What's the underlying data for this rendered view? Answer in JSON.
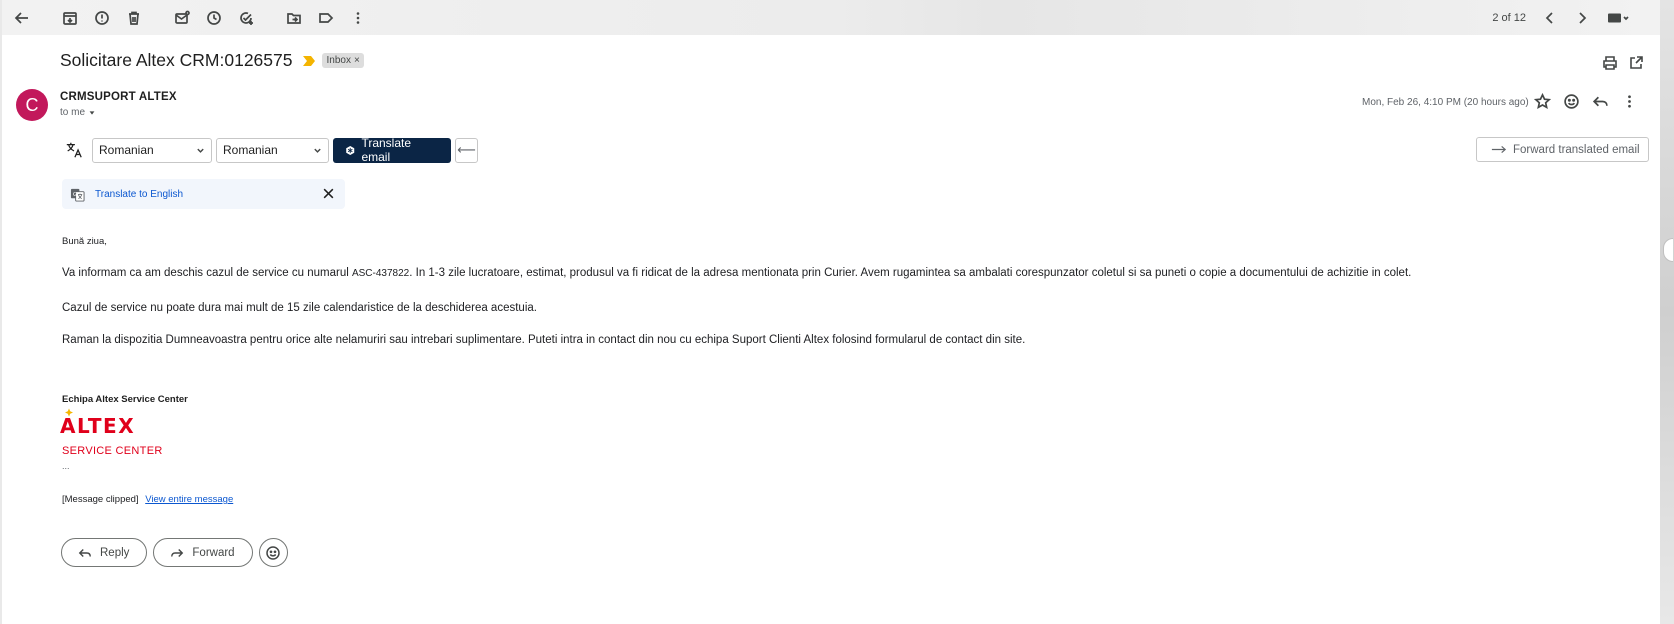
{
  "toolbar": {
    "icons": [
      "back-arrow-icon",
      "archive-icon",
      "report-spam-icon",
      "delete-icon",
      "mark-unread-icon",
      "snooze-icon",
      "add-task-icon",
      "move-to-icon",
      "label-icon",
      "more-vert-icon"
    ],
    "pager": "2 of 12"
  },
  "email": {
    "subject": "Solicitare Altex CRM:0126575",
    "label": "Inbox",
    "label_close": "×",
    "sender_initial": "C",
    "sender": "CRMSUPORT ALTEX",
    "to": "to me",
    "date": "Mon, Feb 26, 4:10 PM (20 hours ago)"
  },
  "translate": {
    "from_lang": "Romanian",
    "to_lang": "Romanian",
    "translate_btn": "Translate email",
    "back_arrow": "⟵",
    "forward_translated": "Forward translated email",
    "translate_to_english": "Translate to English"
  },
  "body": {
    "greeting": "Bună ziua,",
    "p1_a": "Va informam ca am deschis cazul de service cu numarul ",
    "p1_code": "ASC-437822",
    "p1_b": ". In 1-3 zile lucratoare, estimat, produsul va fi ridicat de la adresa mentionata prin Curier. Avem rugamintea sa ambalati corespunzator coletul si sa puneti o copie a documentului de achizitie in colet.",
    "p2": "Cazul de service nu poate dura mai mult de 15 zile calendaristice de la deschiderea acestuia.",
    "p3": "Raman la dispozitia Dumneavoastra pentru orice alte nelamuriri sau intrebari suplimentare. Puteti intra in contact din nou cu echipa Suport Clienti Altex folosind formularul de contact din site.",
    "signature_team": "Echipa Altex Service Center",
    "logo_text": "ALTEX",
    "service_center": "SERVICE CENTER",
    "ellipsis": "...",
    "clipped": "[Message clipped]",
    "view_entire": "View entire message"
  },
  "actions": {
    "reply": "Reply",
    "forward": "Forward"
  },
  "colors": {
    "avatar": "#c2185b",
    "translate_btn": "#0b2545",
    "link": "#0b57d0",
    "altex_red": "#e0001b"
  }
}
